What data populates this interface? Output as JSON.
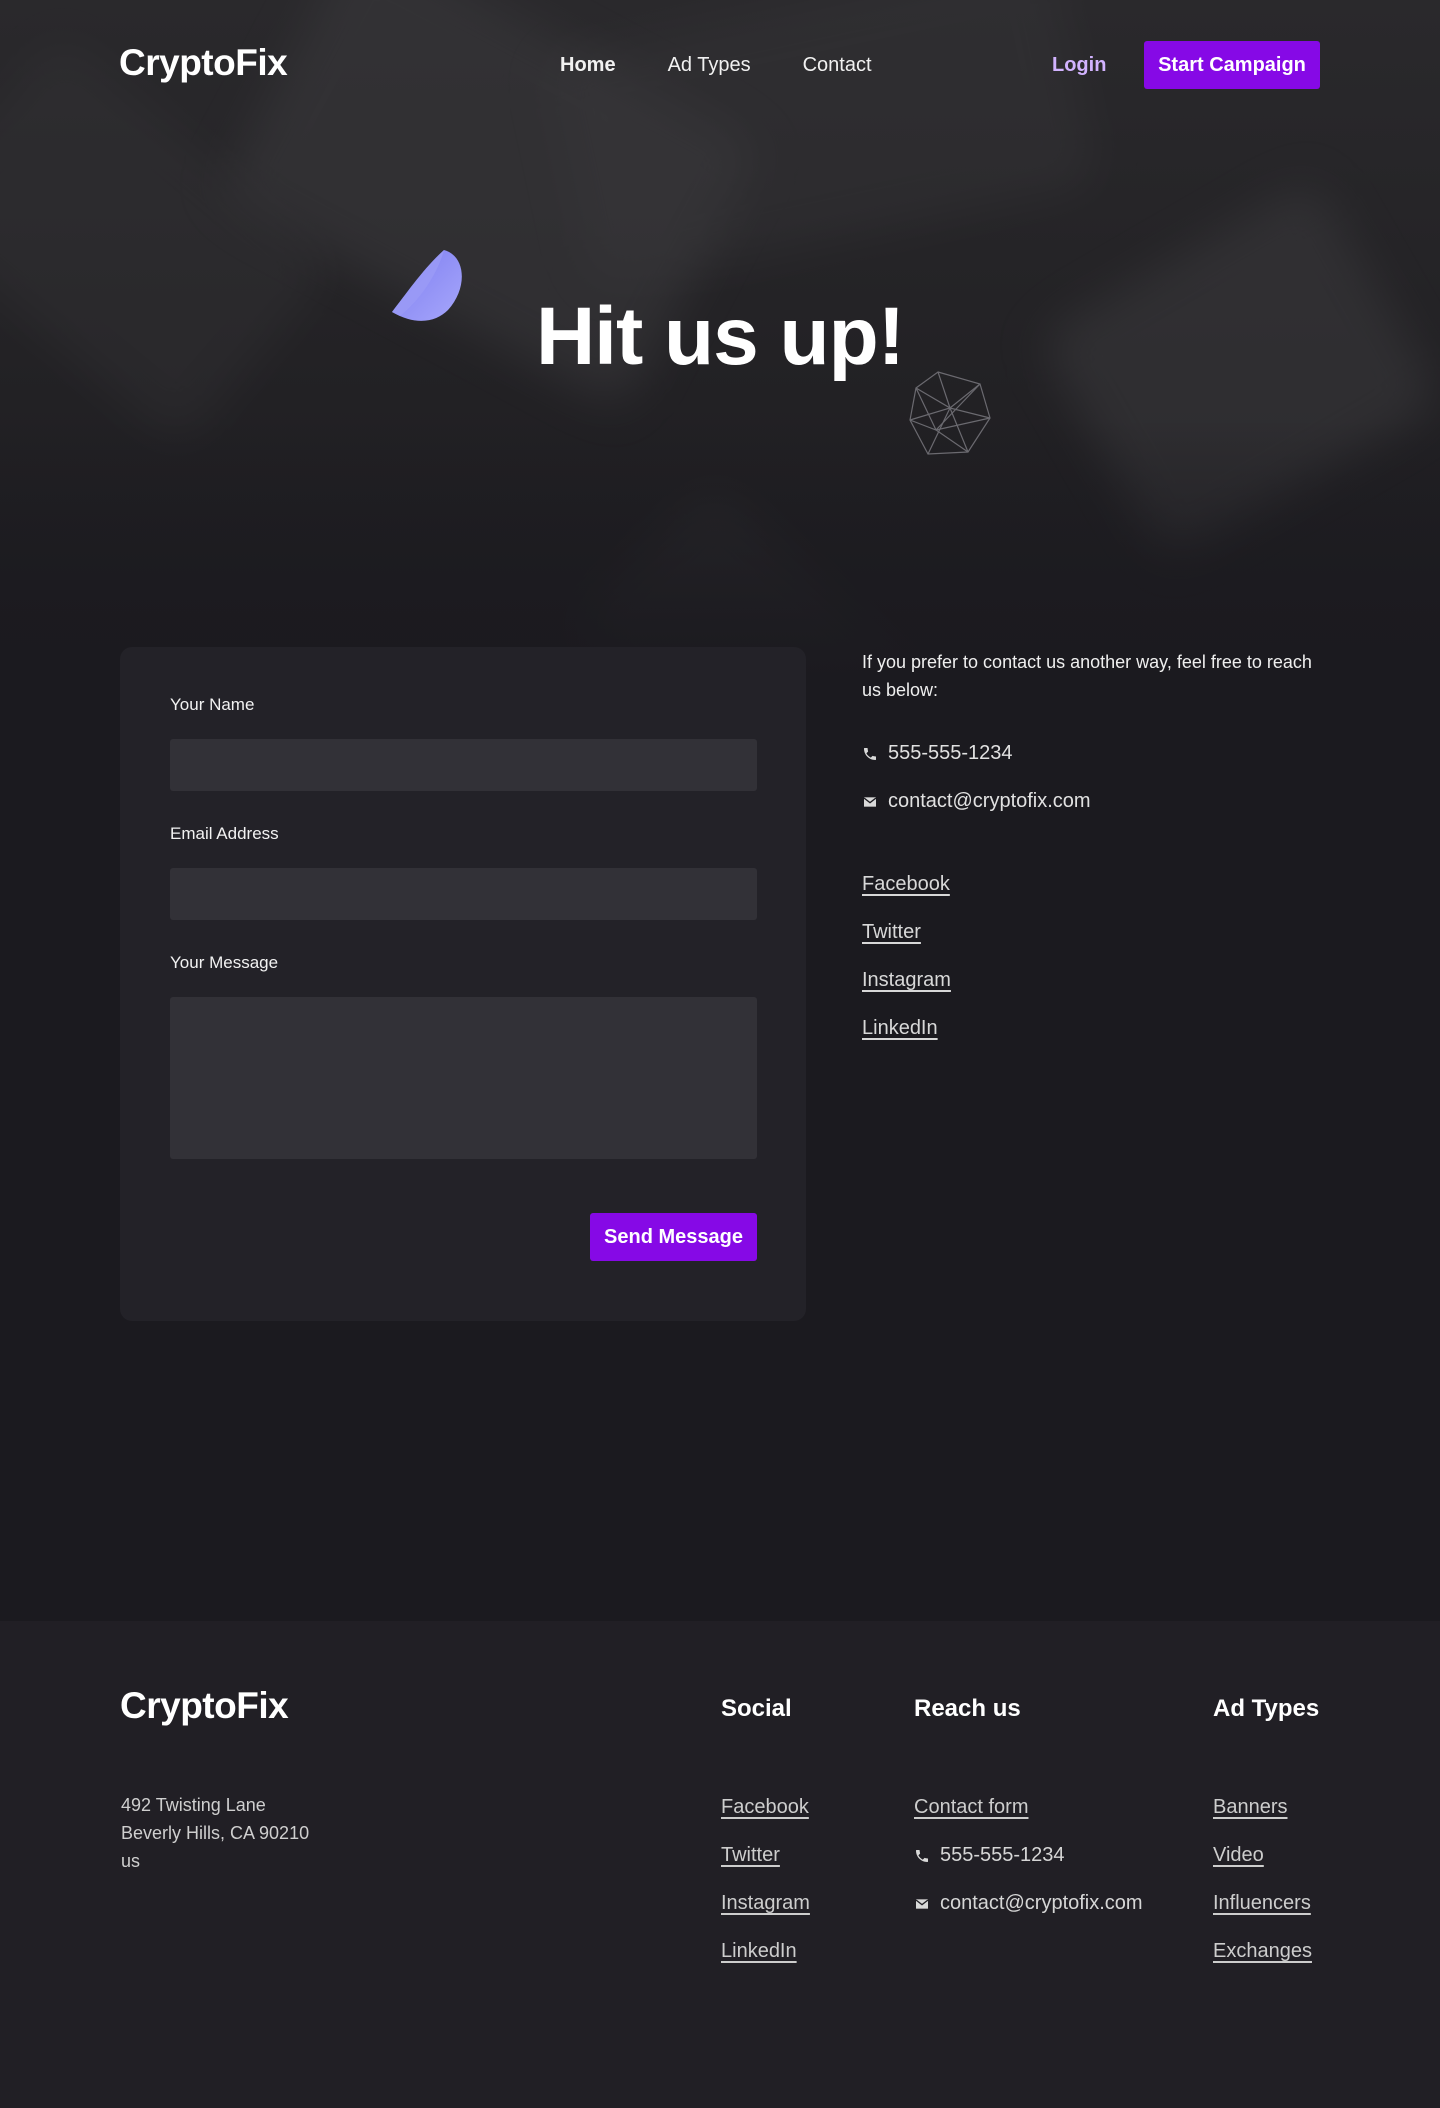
{
  "brand": {
    "name": "CryptoFix"
  },
  "nav": {
    "items": [
      {
        "label": "Home",
        "active": true
      },
      {
        "label": "Ad Types",
        "active": false
      },
      {
        "label": "Contact",
        "active": false
      }
    ],
    "login_label": "Login",
    "cta_label": "Start Campaign"
  },
  "hero": {
    "title": "Hit us up!"
  },
  "form": {
    "name_label": "Your Name",
    "name_value": "",
    "email_label": "Email Address",
    "email_value": "",
    "message_label": "Your Message",
    "message_value": "",
    "submit_label": "Send Message"
  },
  "contact": {
    "intro": "If you prefer to contact us another way, feel free to reach us below:",
    "phone": "555-555-1234",
    "email": "contact@cryptofix.com",
    "social": [
      "Facebook",
      "Twitter",
      "Instagram",
      "LinkedIn"
    ]
  },
  "footer": {
    "logo": "CryptoFix",
    "address": [
      "492 Twisting Lane",
      "Beverly Hills, CA 90210",
      "us"
    ],
    "social": {
      "heading": "Social",
      "links": [
        "Facebook",
        "Twitter",
        "Instagram",
        "LinkedIn"
      ]
    },
    "reach": {
      "heading": "Reach us",
      "contact_form": "Contact form",
      "phone": "555-555-1234",
      "email": "contact@cryptofix.com"
    },
    "ad_types": {
      "heading": "Ad Types",
      "links": [
        "Banners",
        "Video",
        "Influencers",
        "Exchanges"
      ]
    }
  },
  "colors": {
    "accent": "#8609e6",
    "login": "#d2b3ff",
    "background": "#1b1a1f",
    "card": "#232228",
    "footer": "#211f25",
    "deco_shape": "#8f8ff5"
  },
  "icons": {
    "phone": "phone-icon",
    "email": "mail-icon",
    "hero_left": "half-sphere-icon",
    "hero_right": "wireframe-gem-icon"
  }
}
